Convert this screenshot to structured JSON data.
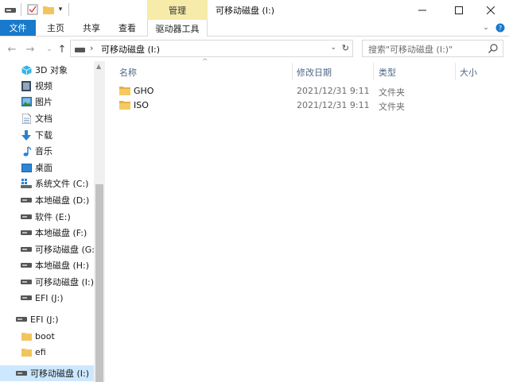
{
  "window": {
    "title": "可移动磁盘 (I:)",
    "context_tab": "管理"
  },
  "ribbon": {
    "tabs": [
      "文件",
      "主页",
      "共享",
      "查看",
      "驱动器工具"
    ]
  },
  "address": {
    "path": "可移动磁盘 (I:)",
    "search_placeholder": "搜索\"可移动磁盘 (I:)\""
  },
  "nav": {
    "items": [
      {
        "label": "3D 对象",
        "icon": "3d-objects-icon"
      },
      {
        "label": "视频",
        "icon": "video-icon"
      },
      {
        "label": "图片",
        "icon": "pictures-icon"
      },
      {
        "label": "文档",
        "icon": "documents-icon"
      },
      {
        "label": "下载",
        "icon": "download-icon"
      },
      {
        "label": "音乐",
        "icon": "music-icon"
      },
      {
        "label": "桌面",
        "icon": "desktop-icon"
      },
      {
        "label": "系统文件 (C:)",
        "icon": "system-drive-icon"
      },
      {
        "label": "本地磁盘 (D:)",
        "icon": "drive-icon"
      },
      {
        "label": "软件 (E:)",
        "icon": "drive-icon"
      },
      {
        "label": "本地磁盘 (F:)",
        "icon": "drive-icon"
      },
      {
        "label": "可移动磁盘 (G:)",
        "icon": "drive-icon"
      },
      {
        "label": "本地磁盘 (H:)",
        "icon": "drive-icon"
      },
      {
        "label": "可移动磁盘 (I:)",
        "icon": "drive-icon"
      },
      {
        "label": "EFI (J:)",
        "icon": "drive-icon"
      }
    ],
    "efi_group": {
      "label": "EFI (J:)",
      "children": [
        "boot",
        "efi"
      ]
    },
    "selected": "可移动磁盘 (I:)"
  },
  "columns": {
    "name": "名称",
    "date": "修改日期",
    "type": "类型",
    "size": "大小"
  },
  "files": [
    {
      "name": "GHO",
      "date": "2021/12/31 9:11",
      "type": "文件夹"
    },
    {
      "name": "ISO",
      "date": "2021/12/31 9:11",
      "type": "文件夹"
    }
  ],
  "colors": {
    "file_tab": "#1979ca",
    "manage_tab": "#f6eba8",
    "selection": "#cce8ff",
    "folder": "#f2c55c"
  }
}
